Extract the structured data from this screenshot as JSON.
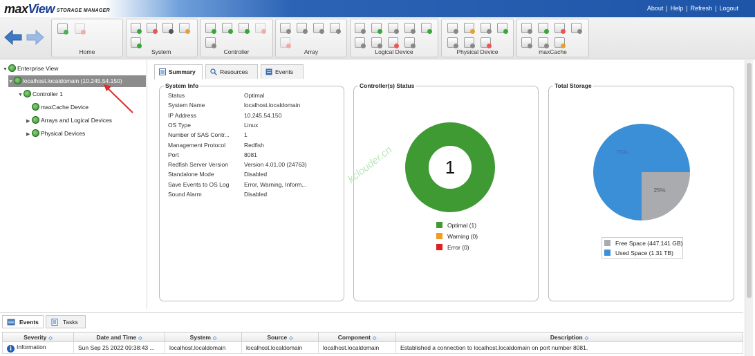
{
  "app": {
    "logo_main": "max",
    "logo_view": "View",
    "logo_sub": "STORAGE MANAGER",
    "links": [
      "About",
      "Help",
      "Refresh",
      "Logout"
    ],
    "link_separator": "|"
  },
  "toolbar": {
    "groups": [
      "Home",
      "System",
      "Controller",
      "Array",
      "Logical Device",
      "Physical Device",
      "maxCache"
    ]
  },
  "tree": {
    "root": "Enterprise View",
    "host": "localhost.localdomain (10.245.54.150)",
    "controller": "Controller 1",
    "maxcache": "maxCache Device",
    "arrays": "Arrays and Logical Devices",
    "physical": "Physical Devices"
  },
  "tabs": [
    "Summary",
    "Resources",
    "Events"
  ],
  "system_info": {
    "title": "System Info",
    "rows": [
      {
        "k": "Status",
        "v": "Optimal"
      },
      {
        "k": "System Name",
        "v": "localhost.localdomain"
      },
      {
        "k": "IP Address",
        "v": "10.245.54.150"
      },
      {
        "k": "OS Type",
        "v": "Linux"
      },
      {
        "k": "Number of SAS Contr...",
        "v": "1"
      },
      {
        "k": "Management Protocol",
        "v": "Redfish"
      },
      {
        "k": "Port",
        "v": "8081"
      },
      {
        "k": "Redfish Server Version",
        "v": "Version 4.01.00 (24763)"
      },
      {
        "k": "Standalone Mode",
        "v": "Disabled"
      },
      {
        "k": "Save Events to OS Log",
        "v": "Error, Warning, Inform..."
      },
      {
        "k": "Sound Alarm",
        "v": "Disabled"
      }
    ]
  },
  "controller_status": {
    "title": "Controller(s) Status",
    "center_value": "1",
    "legend": [
      {
        "label": "Optimal (1)",
        "color": "#3f9a34"
      },
      {
        "label": "Warning (0)",
        "color": "#f39c24"
      },
      {
        "label": "Error (0)",
        "color": "#e02020"
      }
    ]
  },
  "total_storage": {
    "title": "Total Storage",
    "used_pct_label": "75%",
    "free_pct_label": "25%",
    "used_fraction": 0.75,
    "legend": [
      {
        "label": "Free Space (447.141 GB)",
        "color": "#a9abae"
      },
      {
        "label": "Used Space (1.31 TB)",
        "color": "#3b8fd6"
      }
    ]
  },
  "watermark": "kclouder.cn",
  "bottom": {
    "tabs": [
      "Events",
      "Tasks"
    ],
    "columns": [
      "Severity",
      "Date and Time",
      "System",
      "Source",
      "Component",
      "Description"
    ],
    "sort_glyph": "◇",
    "rows": [
      {
        "severity": "Information",
        "datetime": "Sun Sep 25 2022 09:38:43 ...",
        "system": "localhost.localdomain",
        "source": "localhost.localdomain",
        "component": "localhost.localdomain",
        "description": "Established a connection to localhost.localdomain on port number 8081."
      }
    ]
  },
  "colors": {
    "header_blue": "#1f55a8",
    "optimal_green": "#3f9a34",
    "used_blue": "#3b8fd6",
    "free_gray": "#a9abae"
  }
}
